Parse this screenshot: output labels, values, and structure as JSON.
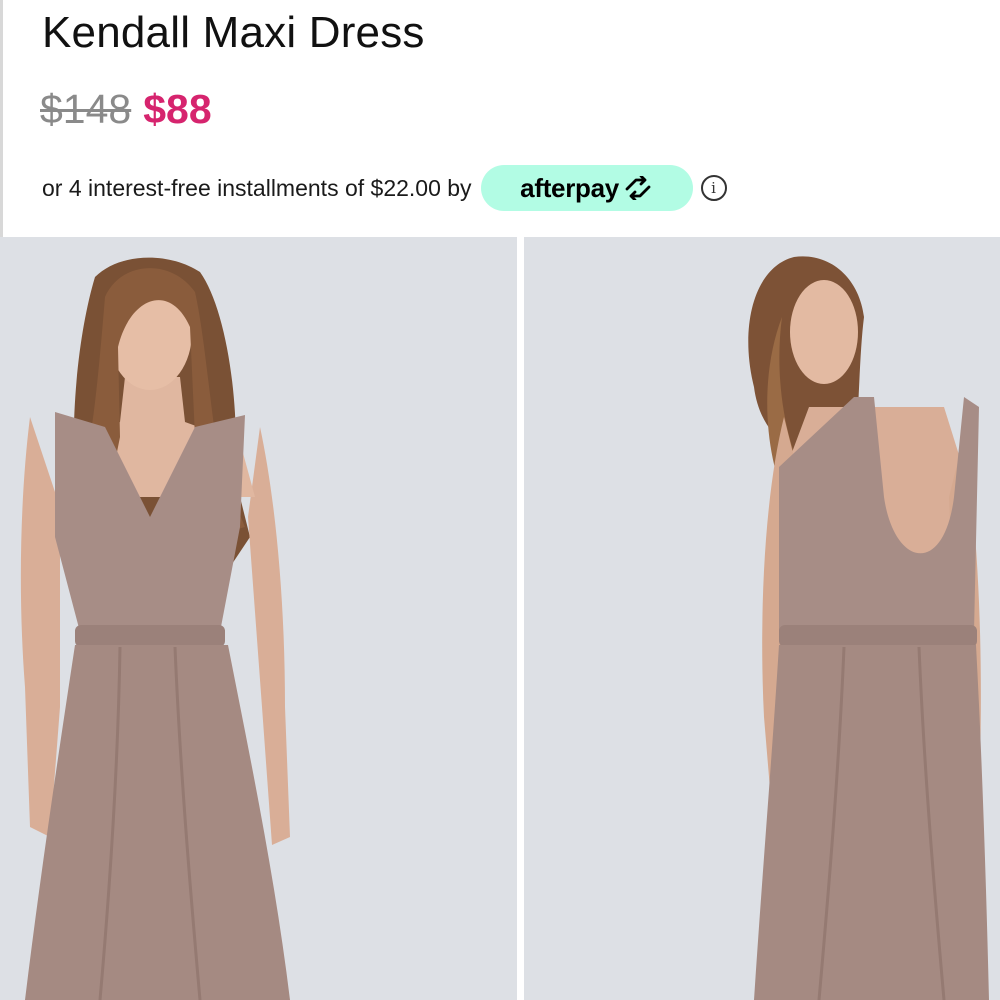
{
  "product": {
    "title": "Kendall Maxi Dress",
    "price_original": "$148",
    "price_sale": "$88"
  },
  "installments": {
    "text": "or 4 interest-free installments of $22.00 by",
    "provider": "afterpay",
    "info_glyph": "i"
  },
  "colors": {
    "sale_price": "#d6246e",
    "afterpay_badge": "#b2fce4",
    "dress": "#a58a82",
    "background": "#dcdfe4"
  },
  "icons": [
    "afterpay-arrows-icon",
    "info-icon"
  ],
  "images": [
    {
      "name": "front-view"
    },
    {
      "name": "back-view"
    }
  ]
}
